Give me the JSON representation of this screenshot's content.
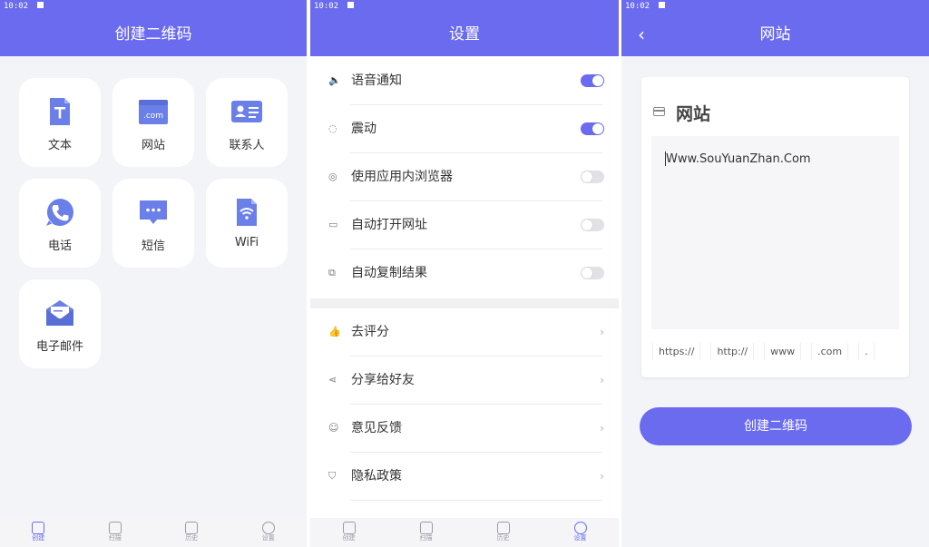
{
  "time": "10:02",
  "panel1": {
    "title": "创建二维码",
    "cards": [
      {
        "label": "文本",
        "icon": "text-doc-icon"
      },
      {
        "label": "网站",
        "icon": "website-icon"
      },
      {
        "label": "联系人",
        "icon": "contact-card-icon"
      },
      {
        "label": "电话",
        "icon": "phone-icon"
      },
      {
        "label": "短信",
        "icon": "sms-icon"
      },
      {
        "label": "WiFi",
        "icon": "wifi-doc-icon"
      },
      {
        "label": "电子邮件",
        "icon": "email-icon"
      }
    ],
    "nav": [
      {
        "label": "创建",
        "active": true
      },
      {
        "label": "扫描",
        "active": false
      },
      {
        "label": "历史",
        "active": false
      },
      {
        "label": "设置",
        "active": false
      }
    ]
  },
  "panel2": {
    "title": "设置",
    "toggles": [
      {
        "label": "语音通知",
        "on": true,
        "icon": "speaker-icon"
      },
      {
        "label": "震动",
        "on": true,
        "icon": "vibrate-icon"
      },
      {
        "label": "使用应用内浏览器",
        "on": false,
        "icon": "globe-icon"
      },
      {
        "label": "自动打开网址",
        "on": false,
        "icon": "browser-window-icon"
      },
      {
        "label": "自动复制结果",
        "on": false,
        "icon": "copy-icon"
      }
    ],
    "links": [
      {
        "label": "去评分",
        "icon": "thumbs-up-icon"
      },
      {
        "label": "分享给好友",
        "icon": "share-icon"
      },
      {
        "label": "意见反馈",
        "icon": "feedback-icon"
      },
      {
        "label": "隐私政策",
        "icon": "shield-icon"
      }
    ],
    "nav": [
      {
        "label": "创建",
        "active": false
      },
      {
        "label": "扫描",
        "active": false
      },
      {
        "label": "历史",
        "active": false
      },
      {
        "label": "设置",
        "active": true
      }
    ]
  },
  "panel3": {
    "title": "网站",
    "card_title": "网站",
    "input_value": "Www.SouYuanZhan.Com",
    "chips": [
      "https://",
      "http://",
      "www",
      ".com",
      "."
    ],
    "button_label": "创建二维码"
  },
  "colors": {
    "accent": "#6b6bf0",
    "card_icon": "#6b7fe8"
  }
}
